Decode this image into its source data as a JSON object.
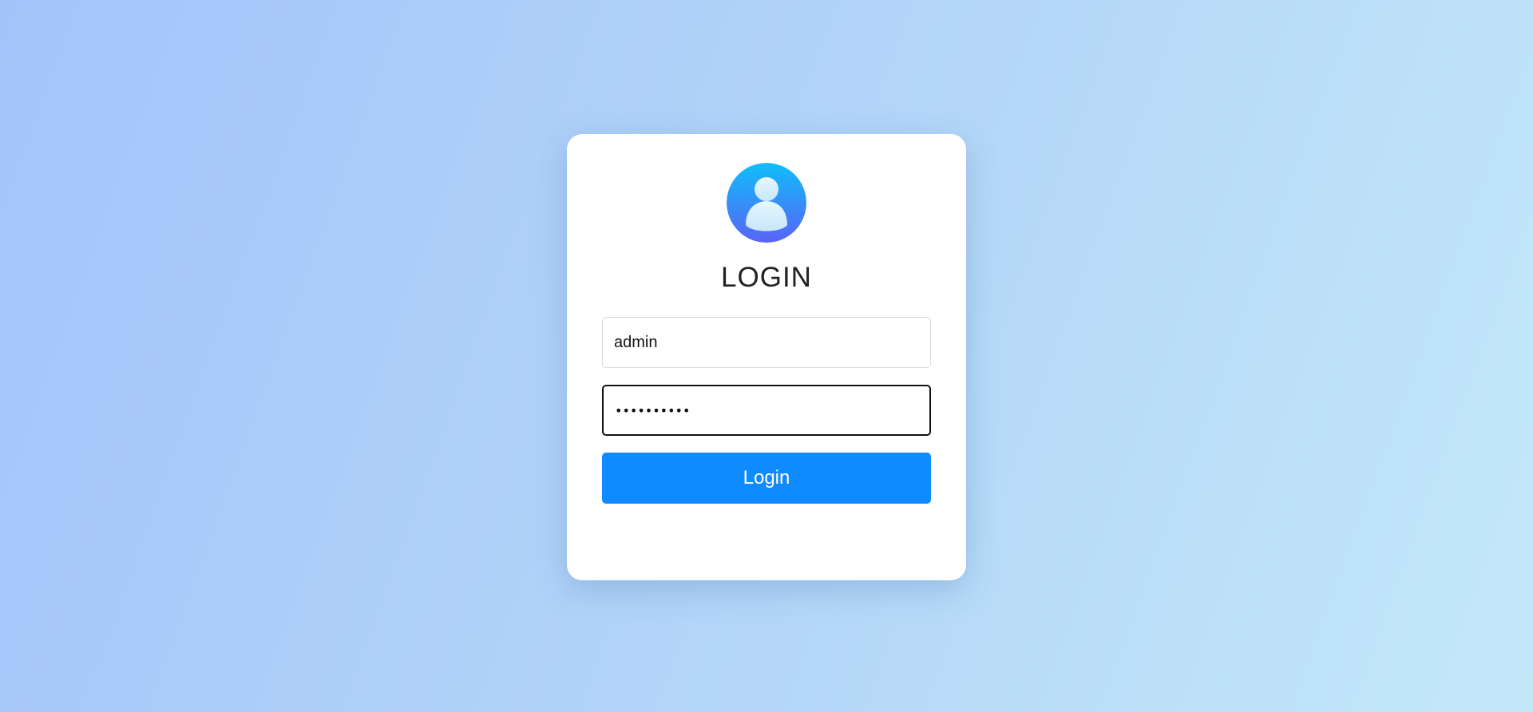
{
  "login": {
    "title": "LOGIN",
    "avatar_icon": "user-avatar-icon",
    "username": {
      "value": "admin",
      "placeholder": ""
    },
    "password": {
      "value": "••••••••••",
      "placeholder": ""
    },
    "submit_label": "Login"
  },
  "colors": {
    "button": "#108aff",
    "avatar_gradient_top": "#0fbefa",
    "avatar_gradient_bottom": "#5a63f7",
    "background_start": "#a3c4fa",
    "background_end": "#c3e9f9"
  }
}
